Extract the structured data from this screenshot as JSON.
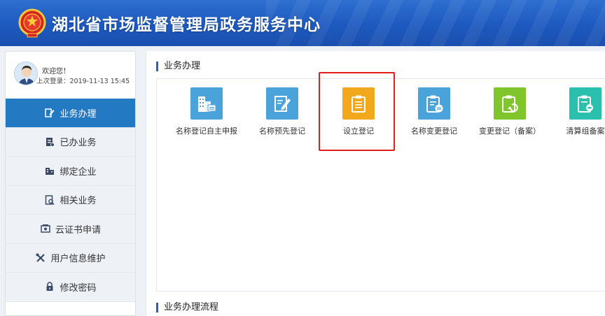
{
  "header": {
    "title": "湖北省市场监督管理局政务服务中心"
  },
  "user": {
    "welcome": "欢迎您！",
    "last_login": "上次登录：2019-11-13 15:45"
  },
  "sidebar": {
    "items": [
      {
        "label": "业务办理",
        "icon": "edit-icon",
        "active": true
      },
      {
        "label": "已办业务",
        "icon": "document-icon"
      },
      {
        "label": "绑定企业",
        "icon": "building-icon"
      },
      {
        "label": "相关业务",
        "icon": "search-document-icon"
      },
      {
        "label": "云证书申请",
        "icon": "certificate-icon"
      },
      {
        "label": "用户信息维护",
        "icon": "tools-icon"
      },
      {
        "label": "修改密码",
        "icon": "lock-icon"
      }
    ]
  },
  "main": {
    "section_title": "业务办理",
    "section_title_2": "业务办理流程",
    "services": [
      {
        "label": "名称登记自主申报",
        "icon": "building-report-icon",
        "color": "#4aa3db"
      },
      {
        "label": "名称预先登记",
        "icon": "pencil-document-icon",
        "color": "#4aa3db"
      },
      {
        "label": "设立登记",
        "icon": "clipboard-icon",
        "color": "#f2a81d"
      },
      {
        "label": "名称变更登记",
        "icon": "clipboard-edit-icon",
        "color": "#4aa3db"
      },
      {
        "label": "变更登记（备案）",
        "icon": "clipboard-refresh-icon",
        "color": "#7fc52b"
      },
      {
        "label": "清算组备案",
        "icon": "clipboard-stamp-icon",
        "color": "#2bbfae"
      }
    ]
  },
  "colors": {
    "header": "#1d59bf",
    "active_menu": "#2379c2",
    "highlight": "#e02020"
  }
}
